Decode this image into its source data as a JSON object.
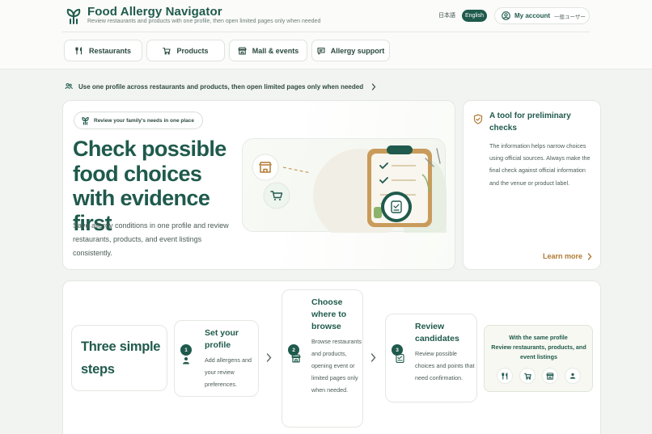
{
  "header": {
    "title": "Food Allergy Navigator",
    "subtitle": "Review restaurants and products with one profile, then open limited pages only when needed",
    "languages": {
      "ja": "日本語",
      "en": "English"
    },
    "account": {
      "label": "My account",
      "user": "一般ユーザー"
    }
  },
  "nav": [
    {
      "label": "Restaurants",
      "icon": "fork-knife-icon"
    },
    {
      "label": "Products",
      "icon": "cart-icon"
    },
    {
      "label": "Mall & events",
      "icon": "store-icon"
    },
    {
      "label": "Allergy support",
      "icon": "chat-icon"
    }
  ],
  "notice": {
    "text": "Use one profile across restaurants and products, then open limited pages only when needed"
  },
  "hero": {
    "pill": "Review your family's needs in one place",
    "title": "Check possible food choices with evidence first",
    "text": "Save allergy conditions in one profile and review restaurants, products, and event listings consistently."
  },
  "tool": {
    "title": "A tool for preliminary checks",
    "text": "The information helps narrow choices using official sources. Always make the final check against official information and the venue or product label.",
    "link": "Learn more"
  },
  "steps": {
    "title": "Three simple steps",
    "items": [
      {
        "num": "1",
        "title": "Set your profile",
        "desc": "Add allergens and your review preferences."
      },
      {
        "num": "2",
        "title": "Choose where to browse",
        "desc": "Browse restaurants and products, opening event or limited pages only when needed."
      },
      {
        "num": "3",
        "title": "Review candidates",
        "desc": "Review possible choices and points that need confirmation."
      }
    ],
    "same_title": "With the same profile",
    "same_text": "Review restaurants, products, and event listings"
  },
  "colors": {
    "brand": "#1f5a4c",
    "accent": "#b07a32",
    "background": "#f2f4f1"
  }
}
